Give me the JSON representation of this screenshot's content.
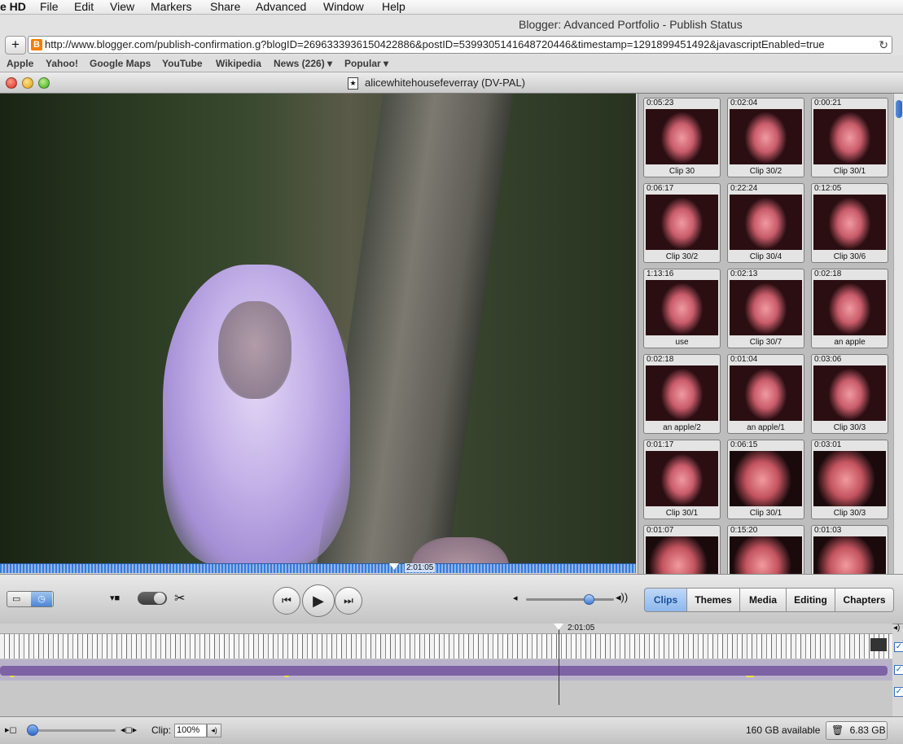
{
  "menubar": {
    "app_name": "e HD",
    "items": [
      "File",
      "Edit",
      "View",
      "Markers",
      "Share",
      "Advanced",
      "Window",
      "Help"
    ]
  },
  "browser": {
    "title": "Blogger: Advanced Portfolio - Publish Status",
    "url": "http://www.blogger.com/publish-confirmation.g?blogID=2696333936150422886&postID=5399305141648720446&timestamp=1291899451492&javascriptEnabled=true",
    "bookmarks": [
      "Apple",
      "Yahoo!",
      "Google Maps",
      "YouTube",
      "Wikipedia",
      "News (226) ▾",
      "Popular ▾"
    ]
  },
  "window": {
    "title": "alicewhitehousefeverray (DV-PAL)"
  },
  "monitor": {
    "playhead_time": "2:01:05",
    "playhead_fraction": 0.62
  },
  "clips": [
    {
      "time": "0:05:23",
      "label": "Clip 30"
    },
    {
      "time": "0:02:04",
      "label": "Clip 30/2"
    },
    {
      "time": "0:00:21",
      "label": "Clip 30/1"
    },
    {
      "time": "0:06:17",
      "label": "Clip 30/2"
    },
    {
      "time": "0:22:24",
      "label": "Clip 30/4"
    },
    {
      "time": "0:12:05",
      "label": "Clip 30/6"
    },
    {
      "time": "1:13:16",
      "label": "use"
    },
    {
      "time": "0:02:13",
      "label": "Clip 30/7"
    },
    {
      "time": "0:02:18",
      "label": "an apple"
    },
    {
      "time": "0:02:18",
      "label": "an apple/2"
    },
    {
      "time": "0:01:04",
      "label": "an apple/1"
    },
    {
      "time": "0:03:06",
      "label": "Clip 30/3"
    },
    {
      "time": "0:01:17",
      "label": "Clip 30/1"
    },
    {
      "time": "0:06:15",
      "label": "Clip 30/1"
    },
    {
      "time": "0:03:01",
      "label": "Clip 30/3"
    },
    {
      "time": "0:01:07",
      "label": ""
    },
    {
      "time": "0:15:20",
      "label": ""
    },
    {
      "time": "0:01:03",
      "label": ""
    }
  ],
  "panes": {
    "tabs": [
      "Clips",
      "Themes",
      "Media",
      "Editing",
      "Chapters"
    ],
    "active": "Clips"
  },
  "controls": {
    "volume_level": 0.71
  },
  "timeline": {
    "timecode": "2:01:05"
  },
  "bottombar": {
    "clip_label": "Clip:",
    "clip_zoom": "100%",
    "available": "160 GB available",
    "trash": "6.83 GB"
  },
  "icons": {
    "scissors": "✂",
    "play": "▶",
    "rewind": "⏮",
    "forward": "⏭",
    "speaker": "🔈"
  }
}
